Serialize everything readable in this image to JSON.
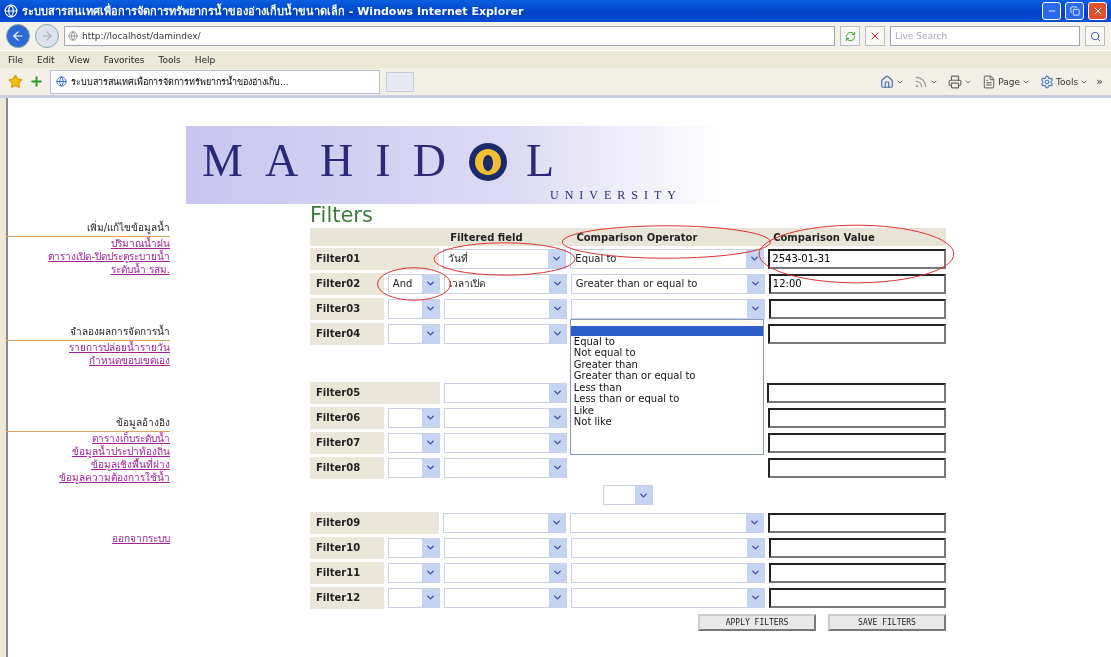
{
  "window": {
    "title": "ระบบสารสนเทศเพื่อการจัดการทรัพยากรน้ำของอ่างเก็บน้ำขนาดเล็ก - Windows Internet Explorer"
  },
  "address_bar": {
    "url": "http://localhost/damindex/"
  },
  "search": {
    "placeholder": "Live Search"
  },
  "menu": [
    "File",
    "Edit",
    "View",
    "Favorites",
    "Tools",
    "Help"
  ],
  "tab": {
    "title": "ระบบสารสนเทศเพื่อการจัดการทรัพยากรน้ำของอ่างเก็บ..."
  },
  "command_bar": [
    {
      "kind": "home"
    },
    {
      "kind": "feeds"
    },
    {
      "kind": "print"
    },
    {
      "kind": "page",
      "label": "Page"
    },
    {
      "kind": "tools",
      "label": "Tools"
    }
  ],
  "overflow": "»",
  "logo": {
    "word": "MAHID",
    "word_end": "L",
    "subtitle": "UNIVERSITY"
  },
  "sidebar": {
    "sections": [
      {
        "heading": "เพิ่ม/แก้ไขข้อมูลน้ำ",
        "links": [
          "ปริมาณน้ำฝน",
          "ตารางเปิด-ปิดประตูระบายน้ำ",
          "ระดับน้ำ รสม."
        ]
      },
      {
        "heading": "จำลองผลการจัดการน้ำ",
        "links": [
          "รายการปล่อยน้ำรายวัน",
          "กำหนดขอบเขตเอง"
        ]
      },
      {
        "heading": "ข้อมูลอ้างอิง",
        "links": [
          "ตารางเก็บระดับน้ำ",
          "ข้อมูลน้ำประปาท้องถิ่น",
          "ข้อมูลเชิงพื้นที่ฝาง",
          "ข้อมูลความต้องการใช้น้ำ"
        ]
      }
    ],
    "logout": "ออกจากระบบ"
  },
  "filters": {
    "title": "Filters",
    "columns": [
      {
        "label": "Filtered field",
        "annotated": false
      },
      {
        "label": "Comparison Operator",
        "annotated": true
      },
      {
        "label": "Comparison Value",
        "annotated": true
      }
    ],
    "groups": [
      {
        "rows": [
          {
            "label": "Filter01",
            "has_connector": false,
            "field": "วันที่",
            "operator": "Equal to",
            "value": "2543-01-31",
            "field_circled": true,
            "operator_covered": false
          },
          {
            "label": "Filter02",
            "has_connector": true,
            "connector": "And",
            "field": "เวลาเปิด",
            "operator": "Greater than or equal to",
            "value": "12:00",
            "connector_circled": true,
            "operator_covered": false
          },
          {
            "label": "Filter03",
            "has_connector": true,
            "operator_covered": false,
            "dropdown": {
              "blank_highlighted": true,
              "options": [
                "Equal to",
                "Not equal to",
                "Greater than",
                "Greater than or equal to",
                "Less than",
                "Less than or equal to",
                "Like",
                "Not like"
              ]
            }
          },
          {
            "label": "Filter04",
            "has_connector": true,
            "operator_covered": true
          }
        ]
      },
      {
        "join_select": false,
        "rows": [
          {
            "label": "Filter05",
            "has_connector": false,
            "operator_covered": true
          },
          {
            "label": "Filter06",
            "has_connector": true,
            "operator_covered": true
          },
          {
            "label": "Filter07",
            "has_connector": true,
            "operator_covered": true
          },
          {
            "label": "Filter08",
            "has_connector": true,
            "operator_covered": true
          }
        ]
      },
      {
        "join_select": true,
        "rows": [
          {
            "label": "Filter09",
            "has_connector": false,
            "operator_covered": false
          },
          {
            "label": "Filter10",
            "has_connector": true,
            "operator_covered": false
          },
          {
            "label": "Filter11",
            "has_connector": true,
            "operator_covered": false
          },
          {
            "label": "Filter12",
            "has_connector": true,
            "operator_covered": false
          }
        ]
      }
    ],
    "buttons": [
      "APPLY FILTERS",
      "SAVE FILTERS"
    ]
  }
}
